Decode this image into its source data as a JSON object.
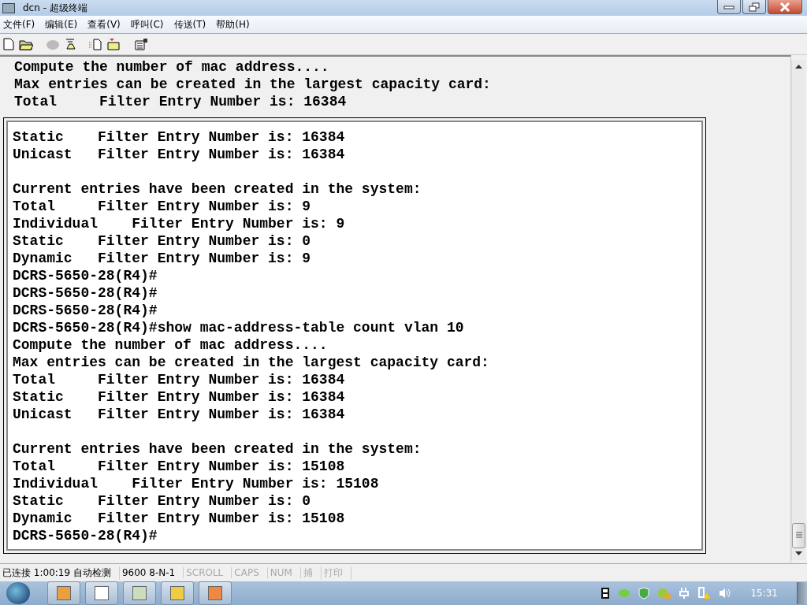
{
  "window": {
    "title": "dcn - 超级终端"
  },
  "menu": [
    "文件(F)",
    "编辑(E)",
    "查看(V)",
    "呼叫(C)",
    "传送(T)",
    "帮助(H)"
  ],
  "terminal": {
    "lines_above": [
      "Compute the number of mac address....",
      "Max entries can be created in the largest capacity card:",
      "Total     Filter Entry Number is: 16384"
    ],
    "blocks_in_box": [
      [
        "Static    Filter Entry Number is: 16384",
        "Unicast   Filter Entry Number is: 16384"
      ],
      [
        "Current entries have been created in the system:",
        "Total     Filter Entry Number is: 9",
        "Individual    Filter Entry Number is: 9",
        "Static    Filter Entry Number is: 0",
        "Dynamic   Filter Entry Number is: 9",
        "DCRS-5650-28(R4)#",
        "DCRS-5650-28(R4)#",
        "DCRS-5650-28(R4)#",
        "DCRS-5650-28(R4)#show mac-address-table count vlan 10",
        "Compute the number of mac address....",
        "Max entries can be created in the largest capacity card:",
        "Total     Filter Entry Number is: 16384",
        "Static    Filter Entry Number is: 16384",
        "Unicast   Filter Entry Number is: 16384"
      ],
      [
        "Current entries have been created in the system:",
        "Total     Filter Entry Number is: 15108",
        "Individual    Filter Entry Number is: 15108",
        "Static    Filter Entry Number is: 0",
        "Dynamic   Filter Entry Number is: 15108",
        "DCRS-5650-28(R4)#"
      ]
    ]
  },
  "status_bar": [
    {
      "text": "已连接 1:00:19 自动检测",
      "disabled": false
    },
    {
      "text": "9600 8-N-1",
      "disabled": false
    },
    {
      "text": "SCROLL",
      "disabled": true
    },
    {
      "text": "CAPS",
      "disabled": true
    },
    {
      "text": "NUM",
      "disabled": true
    },
    {
      "text": "捕",
      "disabled": true
    },
    {
      "text": "打印",
      "disabled": true
    }
  ],
  "taskbar": {
    "clock": "15:31"
  }
}
